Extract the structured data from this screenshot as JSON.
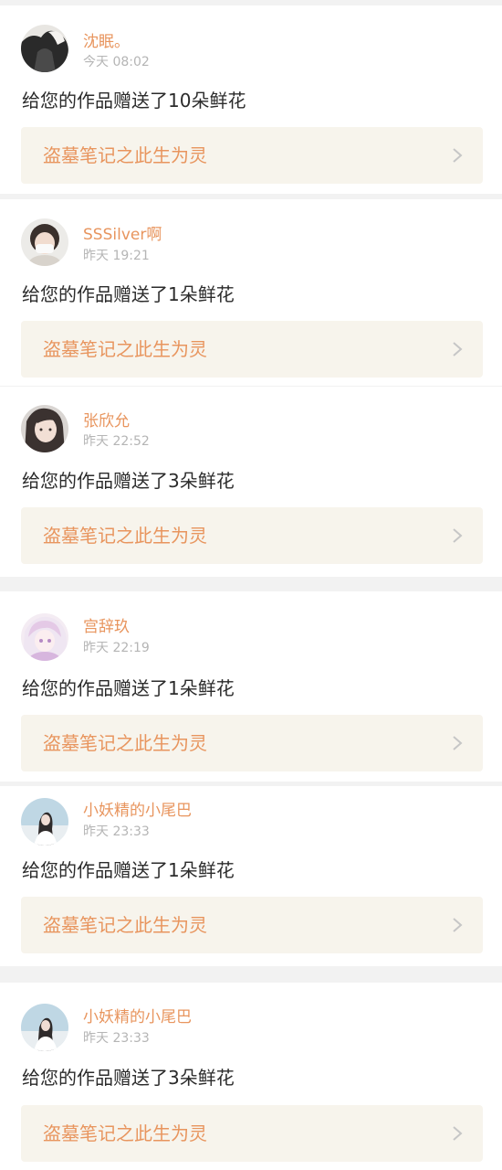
{
  "notifications": [
    {
      "username": "沈眠。",
      "time": "今天 08:02",
      "message": "给您的作品赠送了10朵鲜花",
      "work_title": "盗墓笔记之此生为灵",
      "avatar_icon": "avatar-dark-photo"
    },
    {
      "username": "SSSilver啊",
      "time": "昨天 19:21",
      "message": "给您的作品赠送了1朵鲜花",
      "work_title": "盗墓笔记之此生为灵",
      "avatar_icon": "avatar-masked-face"
    },
    {
      "username": "张欣允",
      "time": "昨天 22:52",
      "message": "给您的作品赠送了3朵鲜花",
      "work_title": "盗墓笔记之此生为灵",
      "avatar_icon": "avatar-girl-portrait"
    },
    {
      "username": "宫辞玖",
      "time": "昨天 22:19",
      "message": "给您的作品赠送了1朵鲜花",
      "work_title": "盗墓笔记之此生为灵",
      "avatar_icon": "avatar-anime-girl"
    },
    {
      "username": "小妖精的小尾巴",
      "time": "昨天 23:33",
      "message": "给您的作品赠送了1朵鲜花",
      "work_title": "盗墓笔记之此生为灵",
      "avatar_icon": "avatar-girl-sky"
    },
    {
      "username": "小妖精的小尾巴",
      "time": "昨天 23:33",
      "message": "给您的作品赠送了3朵鲜花",
      "work_title": "盗墓笔记之此生为灵",
      "avatar_icon": "avatar-girl-sky"
    }
  ],
  "colors": {
    "username": "#e8955e",
    "work_title": "#e8955e",
    "time": "#b5b5b5",
    "message": "#2b2b2b",
    "work_box_bg": "#f7f4ec",
    "page_bg": "#f2f2f2"
  },
  "icons": {
    "chevron": "chevron-right-icon"
  }
}
